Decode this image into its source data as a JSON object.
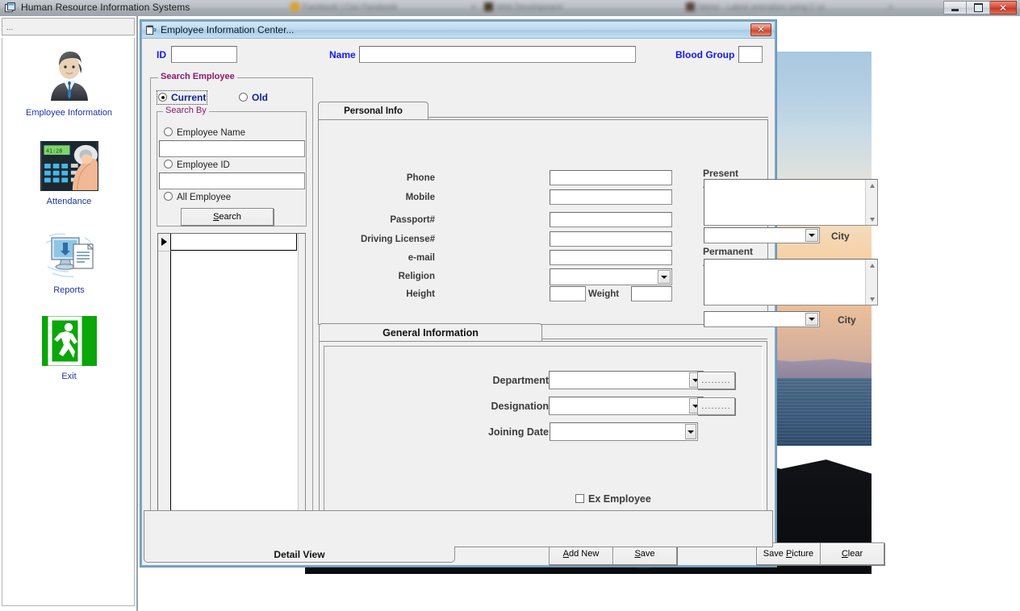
{
  "app": {
    "title": "Human Resource Information Systems",
    "icon": "app-window-icon",
    "sidebar_header_text": "..."
  },
  "taskbar": {
    "background_tabs": [
      {
        "label": "Facebook | Can Facebook",
        "icon": "folder-icon"
      },
      {
        "label": "Web Development",
        "icon": "image-icon"
      },
      {
        "label": "Name - Latest animation using C or",
        "icon": "image-icon"
      }
    ],
    "window_controls": {
      "minimize": "minimize-icon",
      "maximize": "maximize-icon",
      "close": "✕"
    }
  },
  "sidebar": {
    "items": [
      {
        "label": "Employee Information",
        "icon": "employee-person-icon"
      },
      {
        "label": "Attendance",
        "icon": "fingerprint-device-icon"
      },
      {
        "label": "Reports",
        "icon": "computer-report-icon"
      },
      {
        "label": "Exit",
        "icon": "exit-door-icon"
      }
    ]
  },
  "window": {
    "title": "Employee Information Center...",
    "icon": "form-window-icon",
    "close_label": "✕"
  },
  "header": {
    "id_label": "ID",
    "id_value": "",
    "name_label": "Name",
    "name_value": "",
    "blood_group_label": "Blood Group",
    "blood_group_value": ""
  },
  "search_panel": {
    "caption": "Search Employee",
    "caption_color": "#8b1a6b",
    "status_options": [
      {
        "label": "Current",
        "selected": true
      },
      {
        "label": "Old",
        "selected": false
      }
    ],
    "search_by": {
      "caption": "Search By",
      "options": [
        {
          "label": "Employee Name",
          "selected": false
        },
        {
          "label": "Employee ID",
          "selected": false
        },
        {
          "label": "All Employee",
          "selected": false
        }
      ],
      "employee_name_value": "",
      "employee_id_value": "",
      "search_button": "Search",
      "search_button_accel": "S"
    },
    "grid": {
      "row_indicator": "▶",
      "rows": []
    }
  },
  "personal_info_tab": {
    "tab_label": "Personal Info",
    "fields": [
      {
        "label": "Phone",
        "value": "",
        "type": "text"
      },
      {
        "label": "Mobile",
        "value": "",
        "type": "text"
      },
      {
        "label": "Passport#",
        "value": "",
        "type": "text"
      },
      {
        "label": "Driving License#",
        "value": "",
        "type": "text"
      },
      {
        "label": "e-mail",
        "value": "",
        "type": "text"
      },
      {
        "label": "Religion",
        "value": "",
        "type": "combo"
      }
    ],
    "height_label": "Height",
    "height_value": "",
    "weight_label": "Weight",
    "weight_value": "",
    "present_address_label": "Present Address",
    "present_address_value": "",
    "present_city_value": "",
    "present_city_label": "City",
    "permanent_address_label": "Permanent Address",
    "permanent_address_value": "",
    "permanent_city_value": "",
    "permanent_city_label": "City"
  },
  "general_info_tab": {
    "tab_label": "General Information",
    "department_label": "Department",
    "department_value": "",
    "department_browse": ".........",
    "designation_label": "Designation",
    "designation_value": "",
    "designation_browse": ".........",
    "joining_date_label": "Joining Date",
    "joining_date_value": "",
    "ex_employee_label": "Ex Employee",
    "ex_employee_checked": false,
    "buttons": [
      {
        "label": "Add New",
        "accel": "A"
      },
      {
        "label": "Save",
        "accel": "S"
      },
      {
        "label": "Save Picture",
        "accel": "P"
      },
      {
        "label": "Clear",
        "accel": "C"
      }
    ]
  },
  "detail_view_tab": {
    "label": "Detail View"
  },
  "colors": {
    "accent_blue": "#1418f0",
    "caption_purple": "#8b1a6b",
    "nav_link": "#1c36a0",
    "window_border": "#7ea7c4",
    "close_red": "#c94a33",
    "face": "#f0f0f0"
  }
}
